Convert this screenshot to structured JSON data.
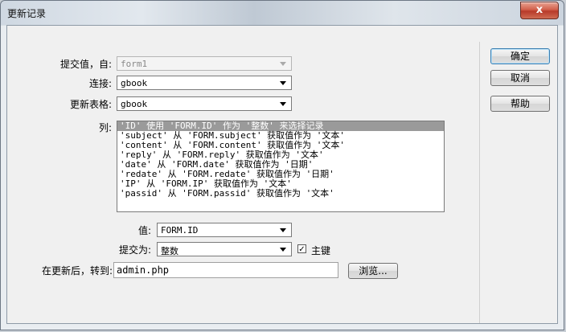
{
  "window": {
    "title": "更新记录",
    "close_label": "x"
  },
  "form": {
    "submit_from_label": "提交值，自:",
    "submit_from_value": "form1",
    "connection_label": "连接:",
    "connection_value": "gbook",
    "table_label": "更新表格:",
    "table_value": "gbook",
    "columns_label": "列:",
    "columns": [
      "'ID' 使用 'FORM.ID' 作为 '整数' 来选择记录",
      "'subject' 从 'FORM.subject' 获取值作为 '文本'",
      "'content' 从 'FORM.content' 获取值作为 '文本'",
      "'reply' 从 'FORM.reply' 获取值作为 '文本'",
      "'date' 从 'FORM.date' 获取值作为 '日期'",
      "'redate' 从 'FORM.redate' 获取值作为 '日期'",
      "'IP' 从 'FORM.IP' 获取值作为 '文本'",
      "'passid' 从 'FORM.passid' 获取值作为 '文本'"
    ],
    "value_label": "值:",
    "value_value": "FORM.ID",
    "submit_as_label": "提交为:",
    "submit_as_value": "整数",
    "primary_key_label": "主键",
    "primary_key_checked": true,
    "after_update_label": "在更新后，转到:",
    "after_update_value": "admin.php",
    "browse_label": "浏览..."
  },
  "buttons": {
    "ok": "确定",
    "cancel": "取消",
    "help": "帮助"
  }
}
